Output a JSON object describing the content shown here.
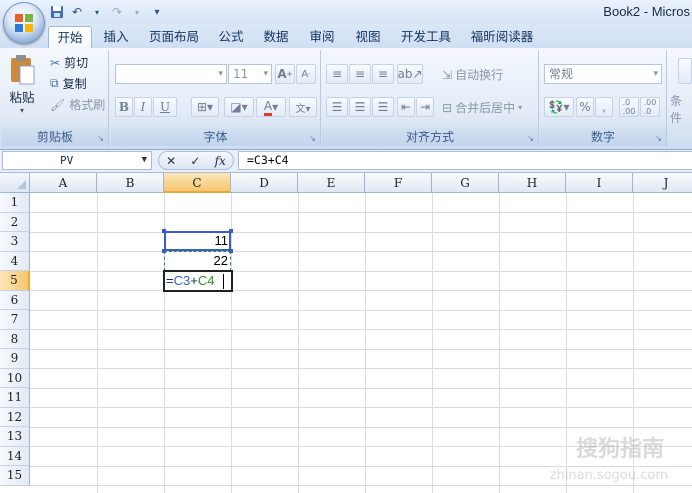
{
  "window": {
    "title": "Book2 - Micros"
  },
  "quick_access": {
    "save_icon": "save-icon",
    "undo_icon": "undo-icon",
    "redo_icon": "redo-icon",
    "customize": "▾"
  },
  "tabs": [
    {
      "label": "开始",
      "active": true
    },
    {
      "label": "插入"
    },
    {
      "label": "页面布局"
    },
    {
      "label": "公式"
    },
    {
      "label": "数据"
    },
    {
      "label": "审阅"
    },
    {
      "label": "视图"
    },
    {
      "label": "开发工具"
    },
    {
      "label": "福昕阅读器"
    }
  ],
  "ribbon": {
    "clipboard": {
      "paste": "粘贴",
      "cut": "剪切",
      "copy": "复制",
      "format_painter": "格式刷",
      "group_label": "剪贴板"
    },
    "font": {
      "font_name": "",
      "font_size": "11",
      "group_label": "字体",
      "bold": "B",
      "italic": "I",
      "underline": "U"
    },
    "alignment": {
      "wrap_text": "自动换行",
      "merge_center": "合并后居中",
      "group_label": "对齐方式"
    },
    "number": {
      "format": "常规",
      "percent": "%",
      "comma": ",",
      "inc_decimal": ".0→.00",
      "dec_decimal": ".00→.0",
      "group_label": "数字"
    },
    "styles_partial": "条件"
  },
  "formula_bar": {
    "name_box": "PV",
    "cancel": "✕",
    "enter": "✓",
    "fx": "fx",
    "formula": "=C3+C4"
  },
  "columns": [
    "A",
    "B",
    "C",
    "D",
    "E",
    "F",
    "G",
    "H",
    "I",
    "J"
  ],
  "rows": [
    "1",
    "2",
    "3",
    "4",
    "5",
    "6",
    "7",
    "8",
    "9",
    "10",
    "11",
    "12",
    "13",
    "14",
    "15"
  ],
  "selected": {
    "column": "C",
    "row": "5"
  },
  "cells": {
    "C3": "11",
    "C4": "22",
    "C5_prefix": "=",
    "C5_ref1": "C3",
    "C5_op": "+",
    "C5_ref2": "C4"
  },
  "colors": {
    "ref1": "#3a5bd0",
    "ref2": "#2f8a2f"
  },
  "watermark": {
    "main": "搜狗指南",
    "sub": "zhinan.sogou.com"
  }
}
